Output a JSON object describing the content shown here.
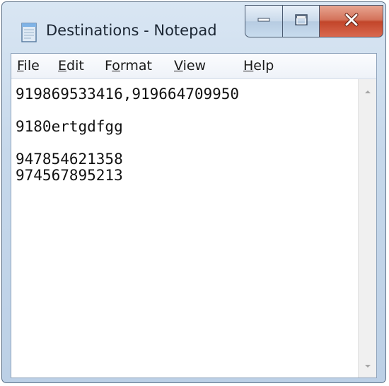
{
  "window": {
    "title": "Destinations - Notepad"
  },
  "menu": {
    "items": [
      {
        "label": "File",
        "accel": "F",
        "rest": "ile"
      },
      {
        "label": "Edit",
        "accel": "E",
        "rest": "dit"
      },
      {
        "label": "Format",
        "pre": "F",
        "accel": "o",
        "rest": "rmat"
      },
      {
        "label": "View",
        "accel": "V",
        "rest": "iew"
      },
      {
        "label": "Help",
        "accel": "H",
        "rest": "elp"
      }
    ]
  },
  "editor": {
    "lines": [
      "919869533416,919664709950",
      "",
      "9180ertgdfgg",
      "",
      "947854621358",
      "974567895213"
    ]
  },
  "icons": {
    "app": "notepad-icon",
    "minimize": "minimize-icon",
    "maximize": "maximize-icon",
    "close": "close-icon",
    "scroll_up": "scroll-up-arrow-icon",
    "scroll_down": "scroll-down-arrow-icon"
  },
  "colors": {
    "close_button": "#c2452a",
    "frame": "#bcd0e6"
  }
}
